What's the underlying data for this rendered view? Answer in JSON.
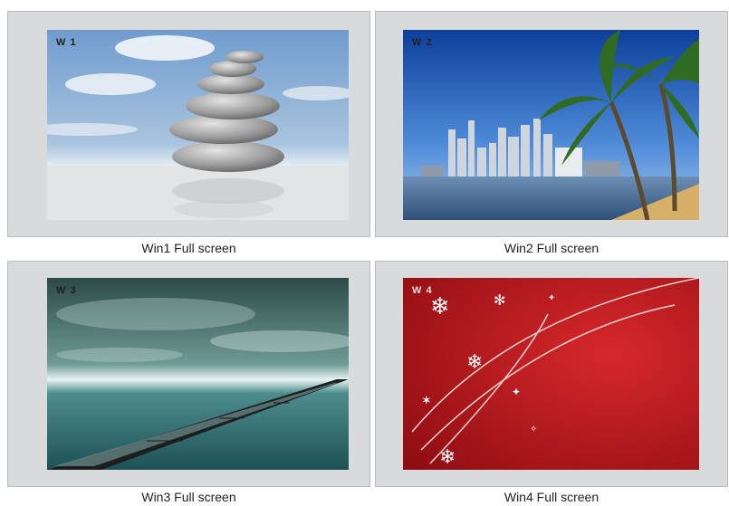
{
  "windows": [
    {
      "tag": "W 1",
      "caption": "Win1 Full screen"
    },
    {
      "tag": "W 2",
      "caption": "Win2 Full screen"
    },
    {
      "tag": "W 3",
      "caption": "Win3 Full screen"
    },
    {
      "tag": "W 4",
      "caption": "Win4 Full screen"
    }
  ],
  "colors": {
    "panel_bg": "#d9dadc",
    "panel_border": "#b9bbbf",
    "win4_red": "#c0191d"
  },
  "icons": [
    "stones-image",
    "city-palm-image",
    "sea-film-image",
    "snowflake-red-image"
  ]
}
